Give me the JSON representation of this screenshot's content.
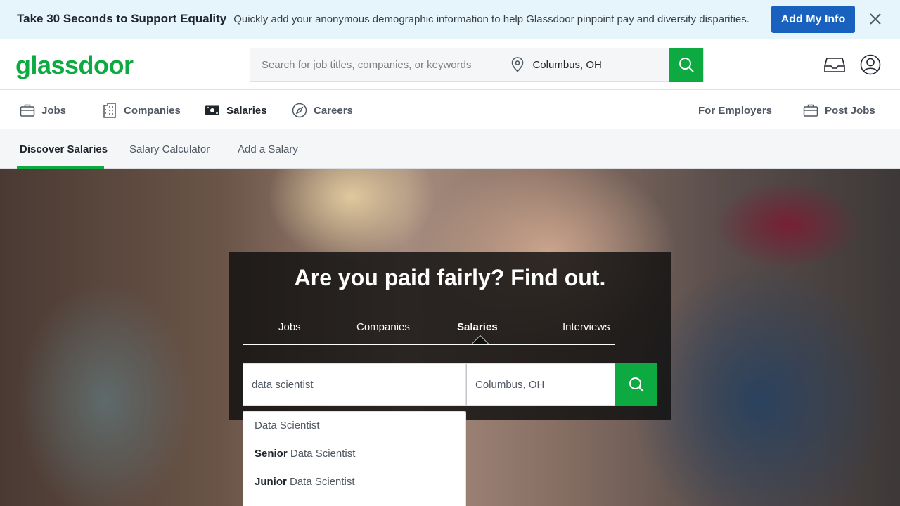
{
  "promo": {
    "headline": "Take 30 Seconds to Support Equality",
    "subtext": "Quickly add your anonymous demographic information to help Glassdoor pinpoint pay and diversity disparities.",
    "cta_label": "Add My Info"
  },
  "header": {
    "logo": "glassdoor",
    "search_placeholder": "Search for job titles, companies, or keywords",
    "location_value": "Columbus, OH"
  },
  "nav": {
    "items": [
      {
        "label": "Jobs",
        "icon": "briefcase-icon"
      },
      {
        "label": "Companies",
        "icon": "building-icon"
      },
      {
        "label": "Salaries",
        "icon": "money-icon"
      },
      {
        "label": "Careers",
        "icon": "compass-icon"
      }
    ],
    "right": [
      {
        "label": "For Employers"
      },
      {
        "label": "Post Jobs",
        "icon": "briefcase-icon"
      }
    ]
  },
  "subnav": {
    "items": [
      "Discover Salaries",
      "Salary Calculator",
      "Add a Salary"
    ],
    "active": "Discover Salaries"
  },
  "hero": {
    "title": "Are you paid fairly? Find out.",
    "tabs": [
      "Jobs",
      "Companies",
      "Salaries",
      "Interviews"
    ],
    "active_tab": "Salaries",
    "keyword_value": "data scientist",
    "location_value": "Columbus, OH",
    "suggestions": [
      {
        "prefix": "",
        "text": "Data Scientist"
      },
      {
        "prefix": "Senior",
        "text": " Data Scientist"
      },
      {
        "prefix": "Junior",
        "text": " Data Scientist"
      }
    ]
  },
  "colors": {
    "brand_green": "#0caa41",
    "cta_blue": "#1861bf",
    "banner_bg": "#e6f4fb"
  }
}
